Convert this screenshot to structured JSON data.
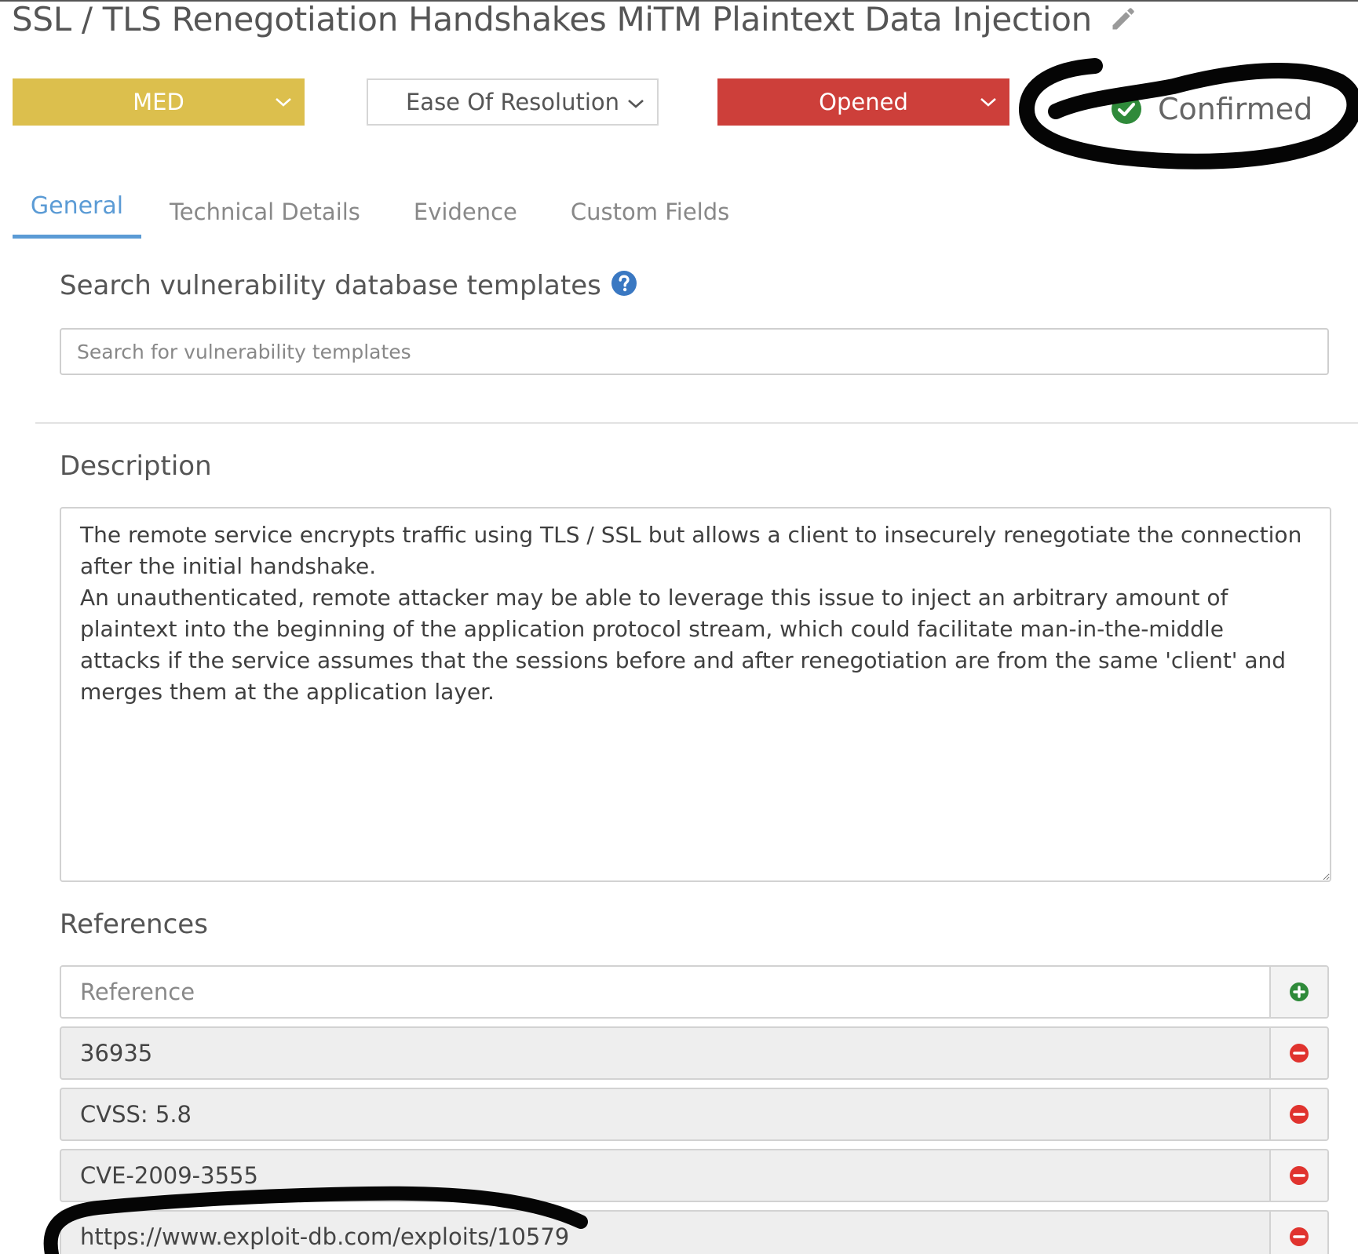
{
  "vulnerability": {
    "title": "SSL / TLS Renegotiation Handshakes MiTM Plaintext Data Injection"
  },
  "dropdowns": {
    "severity": "MED",
    "ease_of_resolution": "Ease Of Resolution",
    "status": "Opened"
  },
  "confirmation": {
    "label": "Confirmed"
  },
  "tabs": [
    {
      "label": "General",
      "active": true
    },
    {
      "label": "Technical Details",
      "active": false
    },
    {
      "label": "Evidence",
      "active": false
    },
    {
      "label": "Custom Fields",
      "active": false
    }
  ],
  "template_search": {
    "heading": "Search vulnerability database templates",
    "placeholder": "Search for vulnerability templates"
  },
  "description": {
    "heading": "Description",
    "text": "The remote service encrypts traffic using TLS / SSL but allows a client to insecurely renegotiate the connection after the initial handshake.\nAn unauthenticated, remote attacker may be able to leverage this issue to inject an arbitrary amount of plaintext into the beginning of the application protocol stream, which could facilitate man-in-the-middle attacks if the service assumes that the sessions before and after renegotiation are from the same 'client' and merges them at the application layer."
  },
  "references": {
    "heading": "References",
    "input_placeholder": "Reference",
    "items": [
      "36935",
      "CVSS: 5.8",
      "CVE-2009-3555",
      "https://www.exploit-db.com/exploits/10579"
    ]
  },
  "colors": {
    "severity_med": "#dcbf4d",
    "status_opened": "#cd3f3a",
    "tab_active": "#5b9bd5",
    "confirmed_check": "#2f8a3a",
    "add_icon": "#2f8a3a",
    "remove_icon": "#e0332e",
    "help_icon": "#3a78c2"
  },
  "icons": {
    "edit": "pencil-icon",
    "dropdown": "chevron-down-icon",
    "confirmed": "check-circle-icon",
    "help": "question-circle-icon",
    "add": "plus-circle-icon",
    "remove": "minus-circle-icon"
  }
}
